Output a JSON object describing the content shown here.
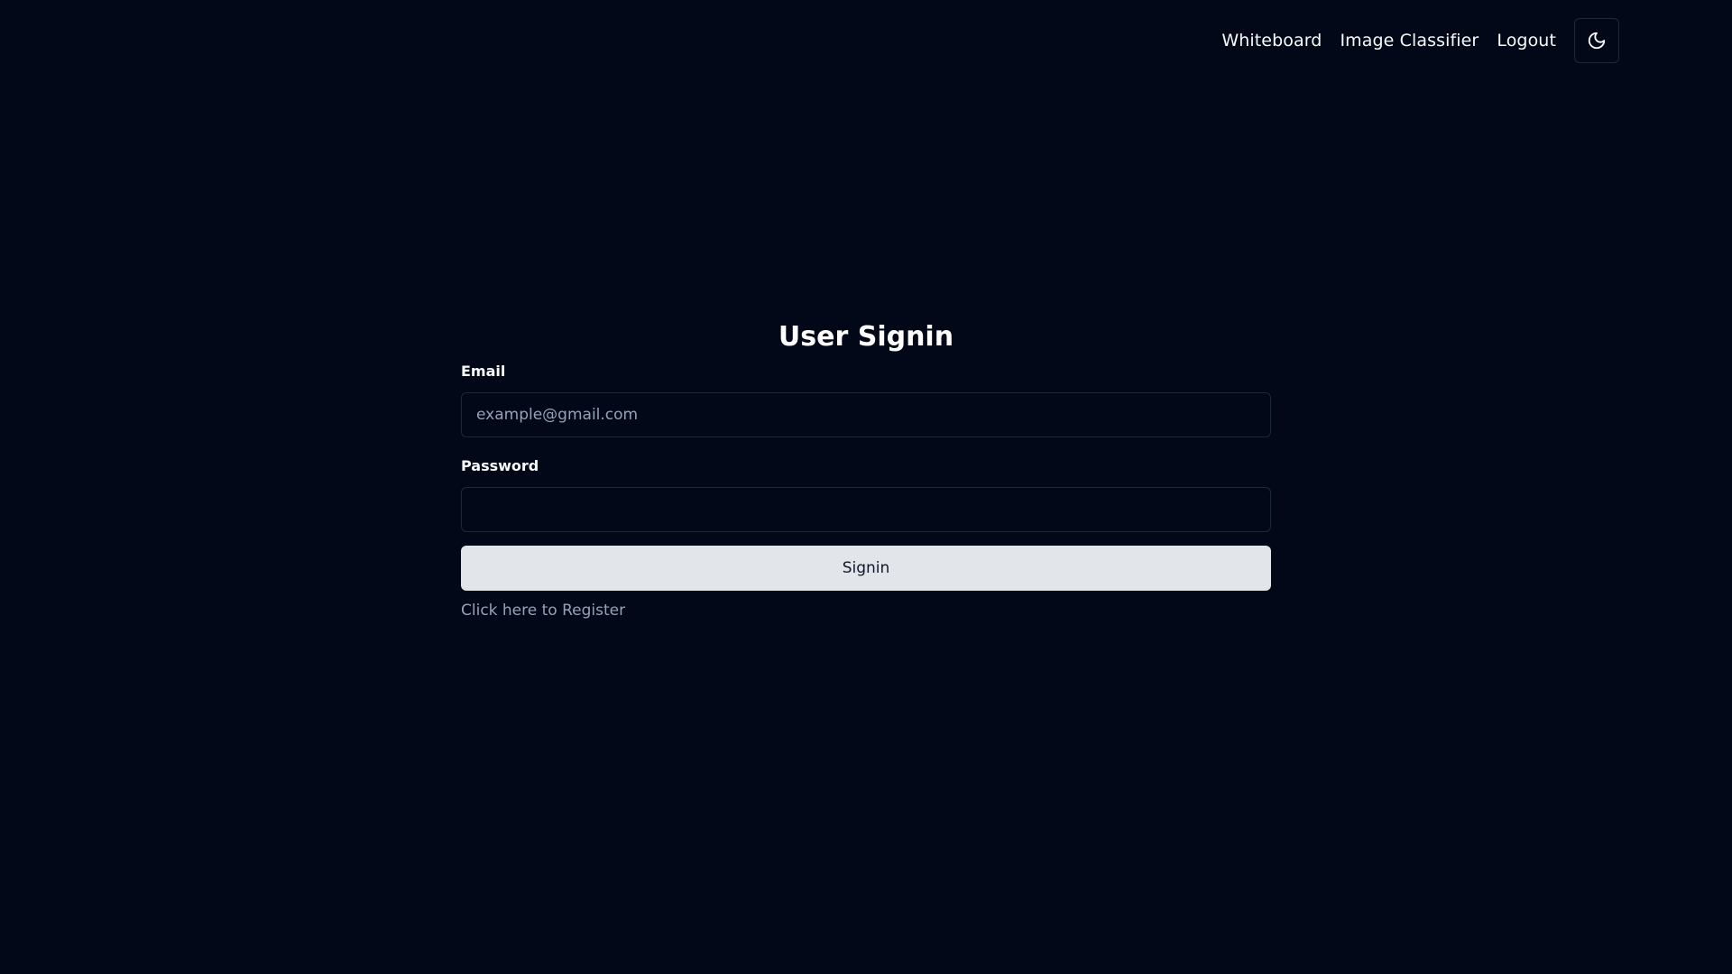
{
  "nav": {
    "links": [
      {
        "label": "Whiteboard"
      },
      {
        "label": "Image Classifier"
      },
      {
        "label": "Logout"
      }
    ],
    "theme_toggle_icon": "moon-icon"
  },
  "signin": {
    "title": "User Signin",
    "email": {
      "label": "Email",
      "placeholder": "example@gmail.com",
      "value": ""
    },
    "password": {
      "label": "Password",
      "placeholder": "",
      "value": ""
    },
    "submit_label": "Signin",
    "register_link": "Click here to Register"
  },
  "colors": {
    "background": "#020817",
    "text": "#f8fafc",
    "muted": "#94a3b8",
    "border": "#1e293b",
    "button_bg": "#e2e5e9",
    "button_text": "#0f172a"
  }
}
